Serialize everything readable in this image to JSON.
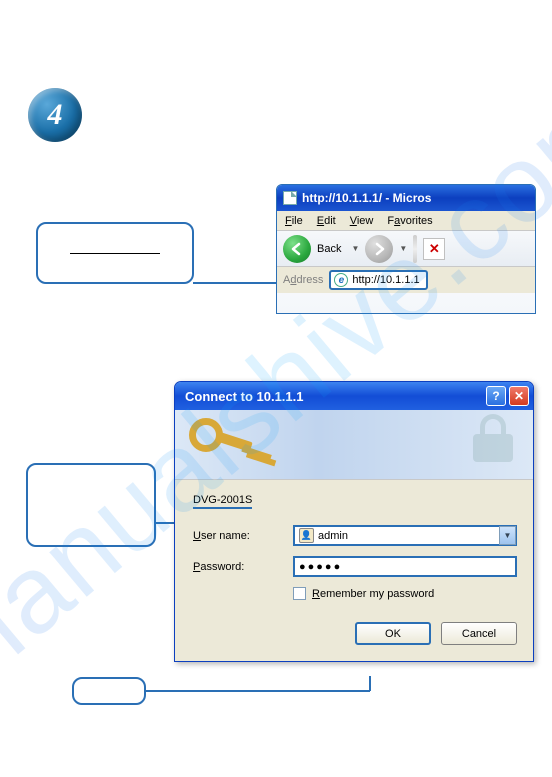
{
  "step_number": "4",
  "ie": {
    "title": "http://10.1.1.1/ - Micros",
    "menu": {
      "file": "File",
      "edit": "Edit",
      "view": "View",
      "favorites": "Favorites"
    },
    "back_label": "Back",
    "address_label": "Address",
    "url": "http://10.1.1.1"
  },
  "dialog": {
    "title": "Connect to 10.1.1.1",
    "realm": "DVG-2001S",
    "user_label": "User name:",
    "user_value": "admin",
    "password_label": "Password:",
    "password_mask": "●●●●●",
    "remember_label": "Remember my password",
    "ok_label": "OK",
    "cancel_label": "Cancel"
  },
  "watermark": "manualshive.com"
}
